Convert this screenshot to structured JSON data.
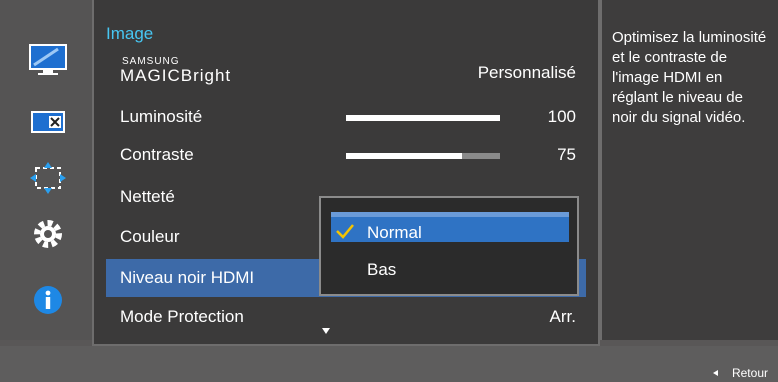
{
  "nav": {
    "icons": [
      "monitor-icon",
      "picture-icon",
      "position-icon",
      "gear-icon",
      "info-icon"
    ]
  },
  "menu": {
    "title": "Image",
    "magic_small": "SAMSUNG",
    "magic_big": "MAGIC",
    "items": [
      {
        "label": "Bright",
        "value": "Personnalisé"
      },
      {
        "label": "Luminosité",
        "value": "100",
        "level": 100
      },
      {
        "label": "Contraste",
        "value": "75",
        "level": 75
      },
      {
        "label": "Netteté",
        "value": ""
      },
      {
        "label": "Couleur",
        "value": ""
      },
      {
        "label": "Niveau noir HDMI",
        "value": ""
      },
      {
        "label": "Mode Protection",
        "value": "Arr."
      }
    ]
  },
  "dropdown": {
    "options": [
      {
        "label": "Normal",
        "selected": true
      },
      {
        "label": "Bas",
        "selected": false
      }
    ]
  },
  "description": "Optimisez la luminosité et le contraste de l'image HDMI en réglant le niveau de noir du signal vidéo.",
  "bottom": {
    "back_label": "Retour"
  },
  "colors": {
    "accent": "#47c6f2",
    "highlight": "#3d6aa8",
    "selected": "#2f73c4"
  }
}
